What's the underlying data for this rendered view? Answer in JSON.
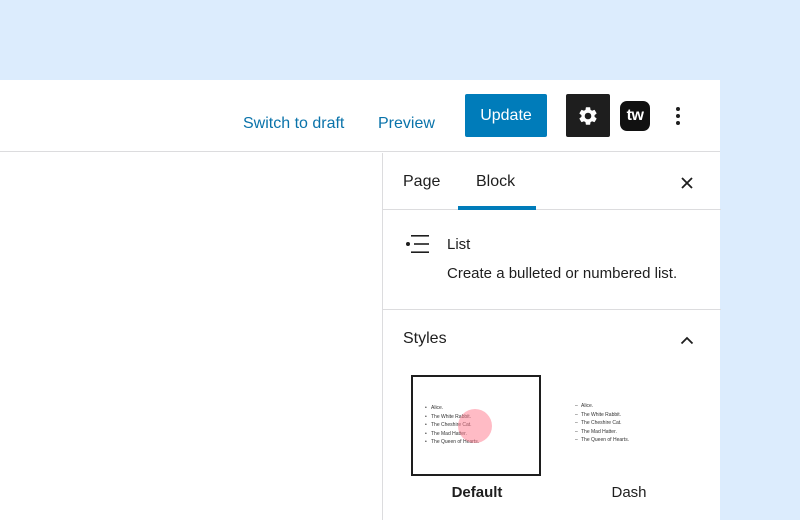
{
  "toolbar": {
    "switch_to_draft": "Switch to draft",
    "preview": "Preview",
    "update": "Update",
    "tw_logo": "tw",
    "settings_icon": "gear-icon",
    "more_icon": "vertical-ellipsis-icon"
  },
  "sidebar": {
    "tabs": [
      {
        "label": "Page",
        "active": false
      },
      {
        "label": "Block",
        "active": true
      }
    ],
    "close_icon": "close-icon",
    "block": {
      "icon": "list-icon",
      "title": "List",
      "description": "Create a bulleted or numbered list."
    },
    "styles": {
      "title": "Styles",
      "expanded": true,
      "options": [
        {
          "label": "Default",
          "selected": true,
          "marker": "•"
        },
        {
          "label": "Dash",
          "selected": false,
          "marker": "–"
        }
      ],
      "preview_items": [
        "Alice.",
        "The White Rabbit.",
        "The Cheshire Cat.",
        "The Mad Hatter.",
        "The Queen of Hearts."
      ]
    }
  },
  "colors": {
    "background": "#dcecfd",
    "accent": "#007cba",
    "link": "#0a73aa",
    "dark": "#1e1e1e"
  }
}
